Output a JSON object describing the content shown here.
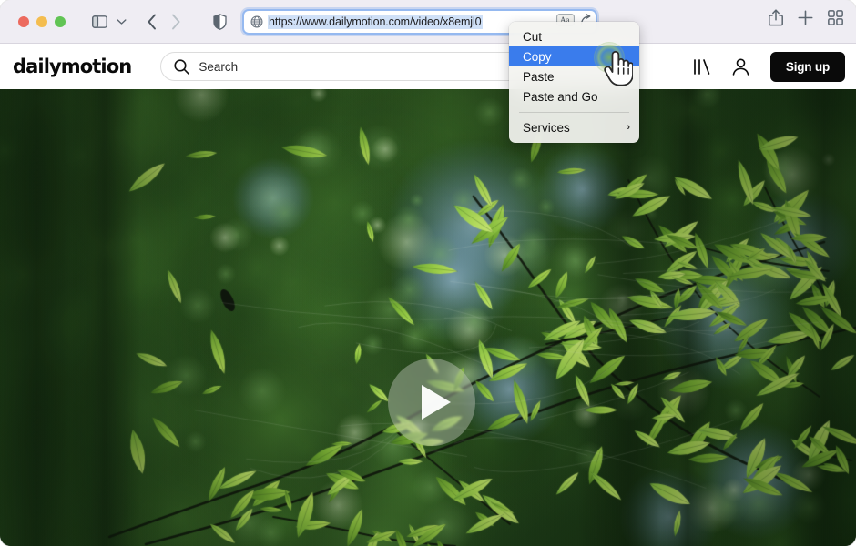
{
  "browser": {
    "name": "safari",
    "traffic_lights": [
      {
        "name": "close",
        "color": "#ec6a5e"
      },
      {
        "name": "minimize",
        "color": "#f4bd4f"
      },
      {
        "name": "maximize",
        "color": "#61c454"
      }
    ],
    "toolbar": {
      "sidebar_icon": "sidebar-icon",
      "sidebar_chevron_icon": "chevron-down-icon",
      "back_icon": "chevron-left-icon",
      "forward_icon": "chevron-right-icon",
      "privacy_shield_icon": "shield-icon",
      "share_icon": "share-icon",
      "new_tab_icon": "plus-icon",
      "tab_overview_icon": "grid-icon"
    },
    "address_bar": {
      "globe_icon": "globe-icon",
      "url": "https://www.dailymotion.com/video/x8emjl0",
      "selected": true,
      "reader_icon": "reader-aa-icon",
      "extension_icon": "share-arrow-icon"
    }
  },
  "context_menu": {
    "items": [
      {
        "label": "Cut",
        "selected": false,
        "submenu": false
      },
      {
        "label": "Copy",
        "selected": true,
        "submenu": false
      },
      {
        "label": "Paste",
        "selected": false,
        "submenu": false
      },
      {
        "label": "Paste and Go",
        "selected": false,
        "submenu": false
      }
    ],
    "services": {
      "label": "Services",
      "submenu": true,
      "arrow": "›"
    },
    "highlight_color": "#3a7cec"
  },
  "site_header": {
    "logo": "dailymotion",
    "search": {
      "icon": "search-icon",
      "placeholder": "Search",
      "value": ""
    },
    "library_icon": "library-icon",
    "account_icon": "account-icon",
    "signup_label": "Sign up",
    "signup_bg": "#0a0a0a"
  },
  "video": {
    "play_icon": "play-icon",
    "scene": "green leaves on branches with blurred forest background",
    "watermark": "",
    "colors": {
      "dark_green": "#1d3318",
      "mid_green": "#3f7a2e",
      "leaf_green": "#8fc84a",
      "bright_leaf": "#b6d95e",
      "sky_blue": "#7fa8c9"
    }
  },
  "cursor": {
    "type": "pointing-hand",
    "click_indicator": true,
    "click_color": "#7eb456"
  }
}
